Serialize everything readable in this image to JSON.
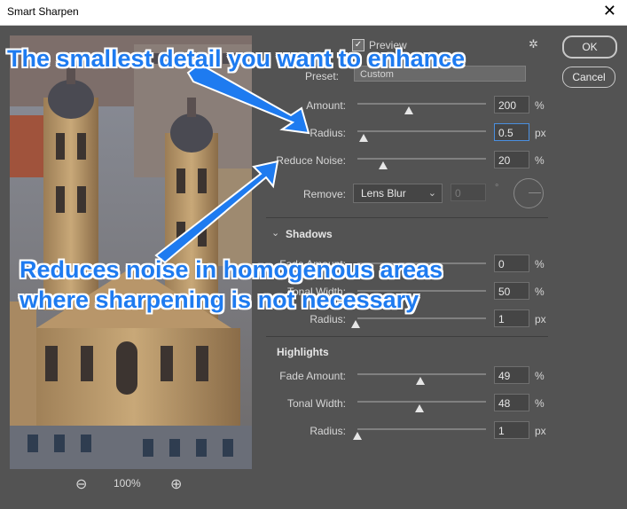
{
  "window": {
    "title": "Smart Sharpen",
    "close_glyph": "✕"
  },
  "preview": {
    "label": "Preview",
    "checked": true,
    "zoom": "100%",
    "zoom_out_glyph": "⊖",
    "zoom_in_glyph": "⊕"
  },
  "buttons": {
    "ok": "OK",
    "cancel": "Cancel"
  },
  "gear_glyph": "✲",
  "preset": {
    "label": "Preset:",
    "value": "Custom"
  },
  "controls": {
    "amount": {
      "label": "Amount:",
      "value": "200",
      "unit": "%",
      "level": 0.4
    },
    "radius": {
      "label": "Radius:",
      "value": "0.5",
      "unit": "px",
      "level": 0.05
    },
    "reduce_noise": {
      "label": "Reduce Noise:",
      "value": "20",
      "unit": "%",
      "level": 0.2
    },
    "remove": {
      "label": "Remove:",
      "value": "Lens Blur",
      "angle": "0",
      "deg": "°"
    }
  },
  "shadows": {
    "title": "Shadows",
    "fade_amount": {
      "label": "Fade Amount:",
      "value": "0",
      "unit": "%"
    },
    "tonal_width": {
      "label": "Tonal Width:",
      "value": "50",
      "unit": "%"
    },
    "radius": {
      "label": "Radius:",
      "value": "1",
      "unit": "px"
    }
  },
  "highlights": {
    "title": "Highlights",
    "fade_amount": {
      "label": "Fade Amount:",
      "value": "49",
      "unit": "%",
      "level": 0.49
    },
    "tonal_width": {
      "label": "Tonal Width:",
      "value": "48",
      "unit": "%",
      "level": 0.48
    },
    "radius": {
      "label": "Radius:",
      "value": "1",
      "unit": "px",
      "level": 0.0
    }
  },
  "annotations": {
    "top": "The smallest detail you want to enhance",
    "bottom_line1": "Reduces noise in homogenous areas",
    "bottom_line2": "where sharpening is not necessary"
  },
  "colors": {
    "accent": "#1e7bf0",
    "panel": "#535353",
    "focus": "#4a8fe0"
  }
}
